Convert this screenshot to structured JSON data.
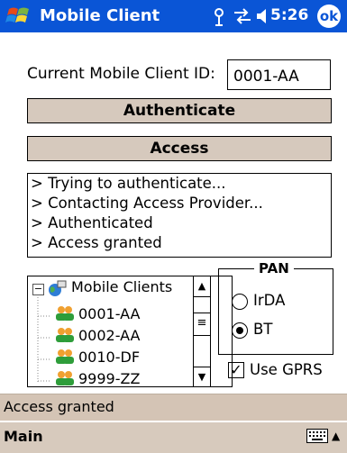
{
  "titlebar": {
    "title": "Mobile Client",
    "time": "5:26",
    "ok_label": "ok",
    "icons": [
      "start-flag-icon",
      "antenna-icon",
      "connectivity-icon",
      "speaker-icon"
    ]
  },
  "form": {
    "id_label": "Current Mobile Client ID:",
    "id_value": "0001-AA",
    "authenticate_label": "Authenticate",
    "access_label": "Access"
  },
  "log": {
    "lines": [
      "> Trying to authenticate...",
      "> Contacting Access Provider...",
      "> Authenticated",
      "> Access granted"
    ]
  },
  "tree": {
    "root": "Mobile Clients",
    "children": [
      "0001-AA",
      "0002-AA",
      "0010-DF",
      "9999-ZZ"
    ]
  },
  "pan": {
    "title": "PAN",
    "options": [
      "IrDA",
      "BT"
    ],
    "selected": "BT",
    "gprs_label": "Use GPRS",
    "gprs_checked": true
  },
  "status": {
    "text": "Access granted"
  },
  "menu": {
    "main_label": "Main"
  },
  "colors": {
    "titlebar": "#0a55d6",
    "button": "#d6c9bd",
    "statusbar": "#d4c4b5"
  }
}
